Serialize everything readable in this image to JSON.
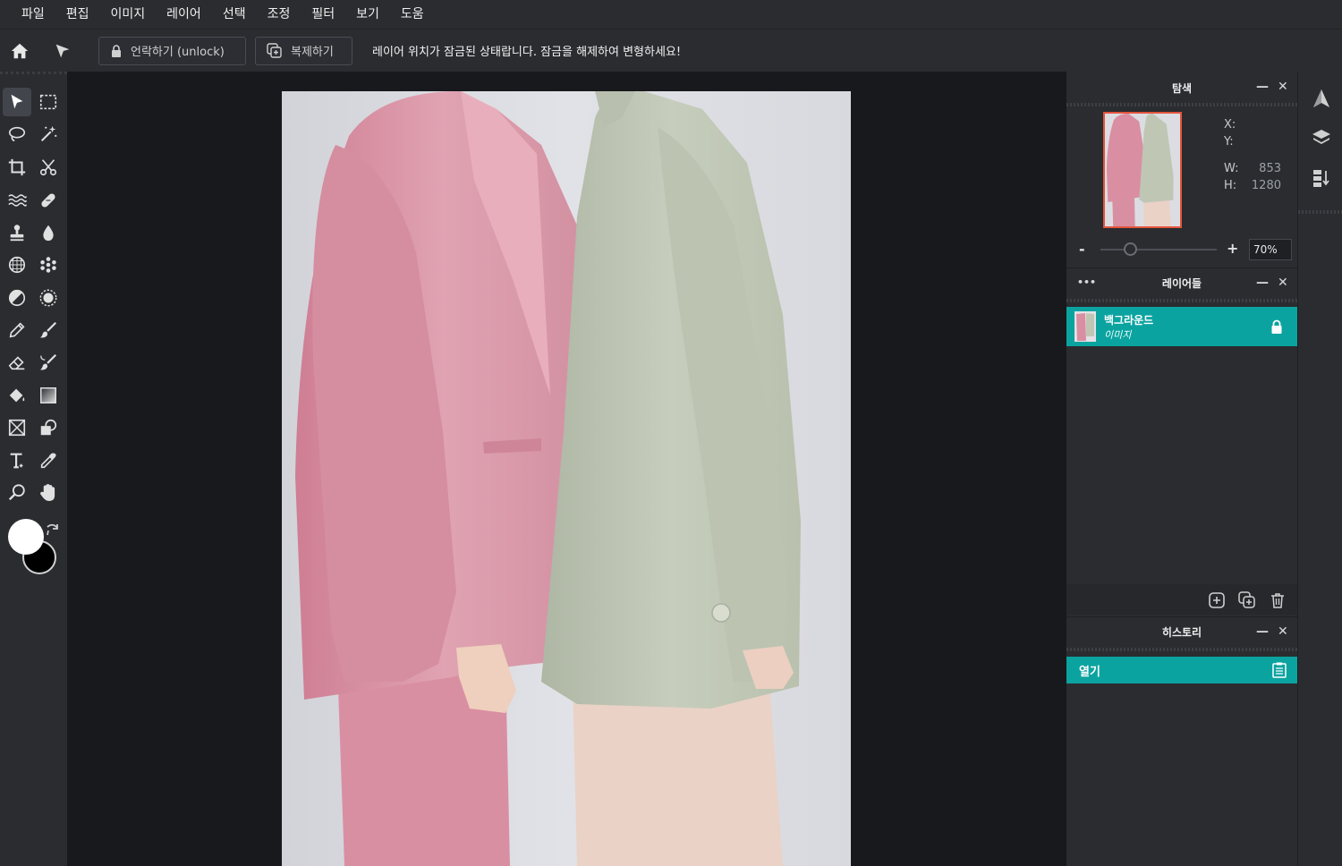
{
  "menu": [
    "파일",
    "편집",
    "이미지",
    "레이어",
    "선택",
    "조정",
    "필터",
    "보기",
    "도움"
  ],
  "options_bar": {
    "unlock_label": "언락하기 (unlock)",
    "duplicate_label": "복제하기",
    "message": "레이어 위치가 잠금된 상태랍니다. 잠금을 해제하여 변형하세요!"
  },
  "colors": {
    "foreground": "#ffffff",
    "background": "#000000",
    "accent": "#0ba3a0",
    "thumb_border": "#e2553c"
  },
  "navigator": {
    "title": "탐색",
    "x_label": "X:",
    "y_label": "Y:",
    "w_label": "W:",
    "w_value": "853",
    "h_label": "H:",
    "h_value": "1280",
    "zoom_minus": "-",
    "zoom_plus": "+",
    "zoom_value": "70%"
  },
  "layers": {
    "title": "레이어들",
    "menu_dots": "•••",
    "items": [
      {
        "name": "백그라운드",
        "type": "이미지"
      }
    ]
  },
  "history": {
    "title": "히스토리",
    "items": [
      {
        "label": "열기"
      }
    ]
  },
  "panel_controls": {
    "minimize": "—",
    "close": "✕"
  }
}
